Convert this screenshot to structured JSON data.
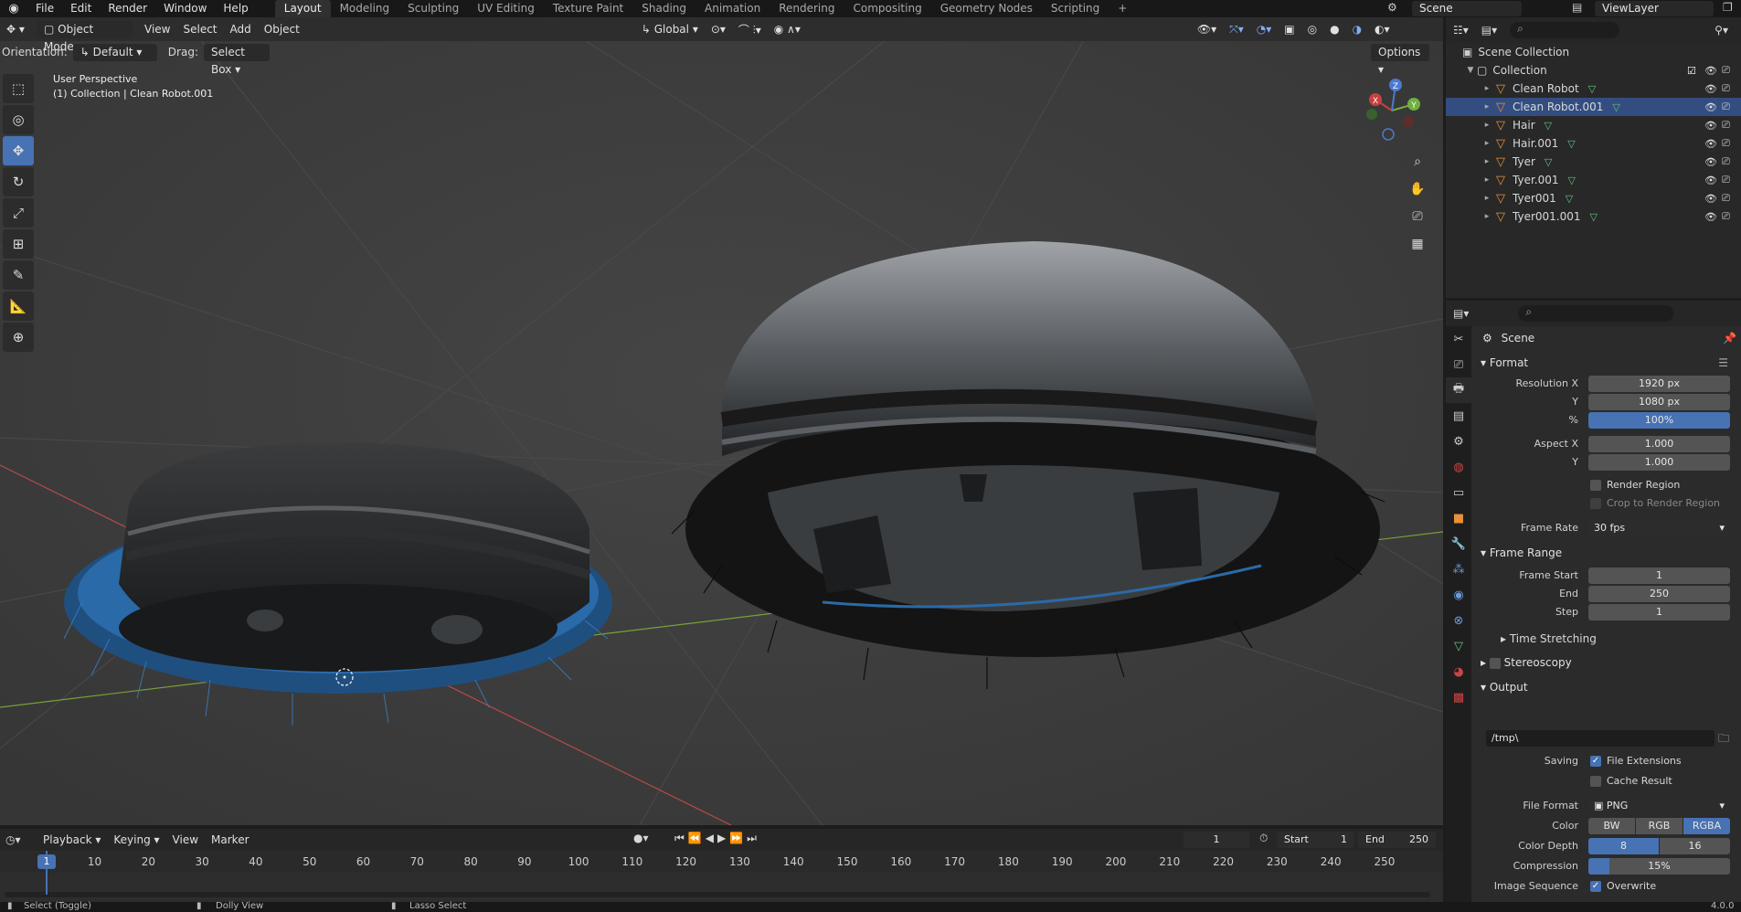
{
  "topbar": {
    "menus": [
      "File",
      "Edit",
      "Render",
      "Window",
      "Help"
    ],
    "workspaces": [
      "Layout",
      "Modeling",
      "Sculpting",
      "UV Editing",
      "Texture Paint",
      "Shading",
      "Animation",
      "Rendering",
      "Compositing",
      "Geometry Nodes",
      "Scripting"
    ],
    "active_workspace": "Layout",
    "add_tab": "+",
    "scene": "Scene",
    "view_layer": "ViewLayer"
  },
  "viewport": {
    "mode": "Object Mode",
    "menus": [
      "View",
      "Select",
      "Add",
      "Object"
    ],
    "transform_orientation": "Global",
    "orientation_label": "Orientation:",
    "orientation_value": "Default",
    "drag_label": "Drag:",
    "drag_value": "Select Box",
    "options": "Options",
    "view_name": "User Perspective",
    "collection_info": "(1) Collection | Clean Robot.001",
    "gizmo_x": "X",
    "gizmo_y": "Y",
    "gizmo_z": "Z",
    "tools": [
      "tweak",
      "cursor",
      "move",
      "rotate",
      "scale",
      "transform",
      "annotate",
      "measure",
      "add-cube"
    ],
    "active_tool": "move"
  },
  "outliner": {
    "root": "Scene Collection",
    "collection": "Collection",
    "items": [
      "Clean Robot",
      "Clean Robot.001",
      "Hair",
      "Hair.001",
      "Tyer",
      "Tyer.001",
      "Tyer001",
      "Tyer001.001"
    ],
    "selected": "Clean Robot.001"
  },
  "properties": {
    "context": "Scene",
    "format": {
      "title": "Format",
      "resolution_x_label": "Resolution X",
      "resolution_x": "1920 px",
      "y_label": "Y",
      "resolution_y": "1080 px",
      "pct_label": "%",
      "percent": "100%",
      "aspect_x_label": "Aspect X",
      "aspect_x": "1.000",
      "aspect_y": "1.000",
      "render_region": "Render Region",
      "crop_region": "Crop to Render Region",
      "frame_rate_label": "Frame Rate",
      "frame_rate": "30 fps"
    },
    "frame_range": {
      "title": "Frame Range",
      "start_label": "Frame Start",
      "start": "1",
      "end_label": "End",
      "end": "250",
      "step_label": "Step",
      "step": "1"
    },
    "time_stretching": "Time Stretching",
    "stereoscopy": "Stereoscopy",
    "output": {
      "title": "Output",
      "path": "/tmp\\",
      "saving_label": "Saving",
      "file_extensions": "File Extensions",
      "cache_result": "Cache Result",
      "file_format_label": "File Format",
      "file_format": "PNG",
      "color_label": "Color",
      "color_options": [
        "BW",
        "RGB",
        "RGBA"
      ],
      "color_selected": "RGBA",
      "depth_label": "Color Depth",
      "depth_options": [
        "8",
        "16"
      ],
      "depth_selected": "8",
      "compression_label": "Compression",
      "compression": "15%",
      "compression_fraction": 0.15,
      "image_sequence_label": "Image Sequence",
      "overwrite": "Overwrite"
    }
  },
  "timeline": {
    "menus": [
      "Playback",
      "Keying",
      "View",
      "Marker"
    ],
    "current_frame": "1",
    "start_label": "Start",
    "start": "1",
    "end_label": "End",
    "end": "250",
    "ruler": [
      "1",
      "10",
      "20",
      "30",
      "40",
      "50",
      "60",
      "70",
      "80",
      "90",
      "100",
      "110",
      "120",
      "130",
      "140",
      "150",
      "160",
      "170",
      "180",
      "190",
      "200",
      "210",
      "220",
      "230",
      "240",
      "250"
    ]
  },
  "status": {
    "select": "Select (Toggle)",
    "dolly": "Dolly View",
    "lasso": "Lasso Select",
    "version": "4.0.0"
  },
  "colors": {
    "accent": "#4772b3",
    "object_icon": "#e8913a",
    "mesh_icon": "#62c384",
    "fur_blue": "#2a6aa8"
  }
}
